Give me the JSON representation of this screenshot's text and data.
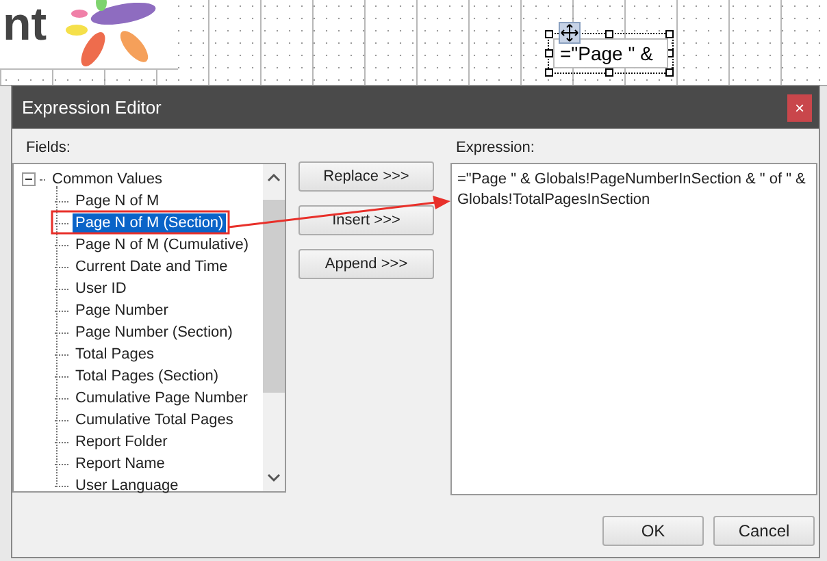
{
  "canvas": {
    "logo_text": "nt",
    "textbox": "=\"Page \" &"
  },
  "dialog": {
    "title": "Expression Editor",
    "close": "×",
    "fields_label": "Fields:",
    "tree": {
      "label": "Common Values",
      "expanded": true,
      "children": [
        {
          "label": "Page N of M",
          "selected": false
        },
        {
          "label": "Page N of M (Section)",
          "selected": true
        },
        {
          "label": "Page N of M (Cumulative)",
          "selected": false
        },
        {
          "label": "Current Date and Time",
          "selected": false
        },
        {
          "label": "User ID",
          "selected": false
        },
        {
          "label": "Page Number",
          "selected": false
        },
        {
          "label": "Page Number (Section)",
          "selected": false
        },
        {
          "label": "Total Pages",
          "selected": false
        },
        {
          "label": "Total Pages (Section)",
          "selected": false
        },
        {
          "label": "Cumulative Page Number",
          "selected": false
        },
        {
          "label": "Cumulative Total Pages",
          "selected": false
        },
        {
          "label": "Report Folder",
          "selected": false
        },
        {
          "label": "Report Name",
          "selected": false
        },
        {
          "label": "User Language",
          "selected": false
        }
      ]
    },
    "actions": [
      "Replace >>>",
      "Insert >>>",
      "Append >>>"
    ],
    "expression_label": "Expression:",
    "expression": "=\"Page \" & Globals!PageNumberInSection & \" of \" & Globals!TotalPagesInSection",
    "buttons": [
      "OK",
      "Cancel"
    ]
  }
}
